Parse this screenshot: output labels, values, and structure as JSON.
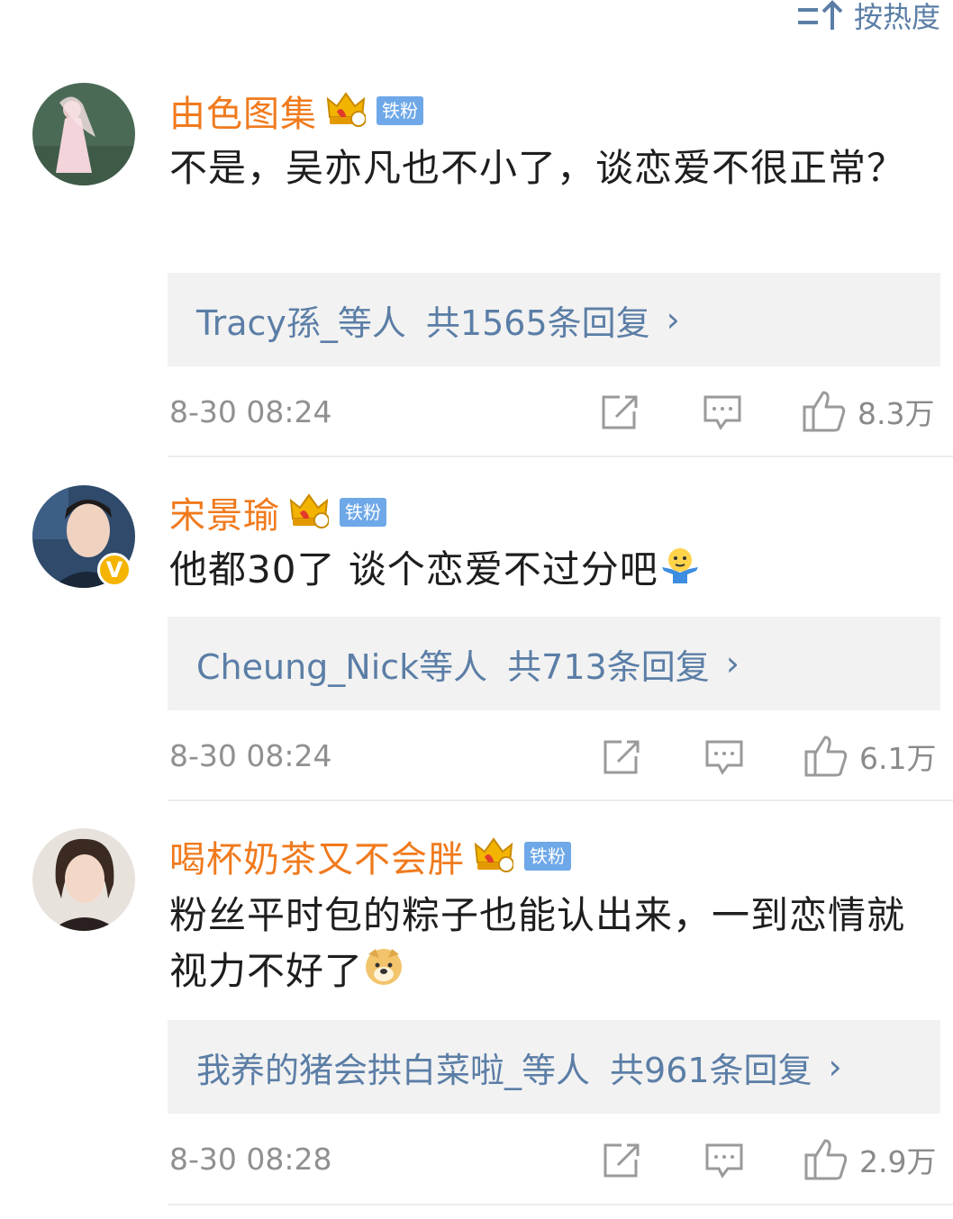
{
  "sort": {
    "label": "按热度",
    "icon": "sort-icon"
  },
  "colors": {
    "username": "#f07a1d",
    "link": "#5b7ea6",
    "badge": "#6ea8e8",
    "time": "#909090",
    "reply_bg": "#f2f2f2"
  },
  "comments": [
    {
      "username": "由色图集",
      "crown_level": "2",
      "badge": "铁粉",
      "content": "不是，吴亦凡也不小了，谈恋爱不很正常？",
      "reply_users": "Tracy孫_等人",
      "reply_count": "共1565条回复",
      "time": "8-30 08:24",
      "likes": "8.3万",
      "verified": false
    },
    {
      "username": "宋景瑜",
      "crown_level": "5",
      "badge": "铁粉",
      "content": "他都30了 谈个恋爱不过分吧",
      "emoji": "shrug-emoji",
      "reply_users": "Cheung_Nick等人",
      "reply_count": "共713条回复",
      "time": "8-30 08:24",
      "likes": "6.1万",
      "verified": true,
      "verified_mark": "V"
    },
    {
      "username": "喝杯奶茶又不会胖",
      "crown_level": "2",
      "badge": "铁粉",
      "content": "粉丝平时包的粽子也能认出来，一到恋情就视力不好了",
      "emoji": "doge-emoji",
      "reply_users": "我养的猪会拱白菜啦_等人",
      "reply_count": "共961条回复",
      "time": "8-30 08:28",
      "likes": "2.9万",
      "verified": false
    }
  ],
  "reply_chevron": "›"
}
